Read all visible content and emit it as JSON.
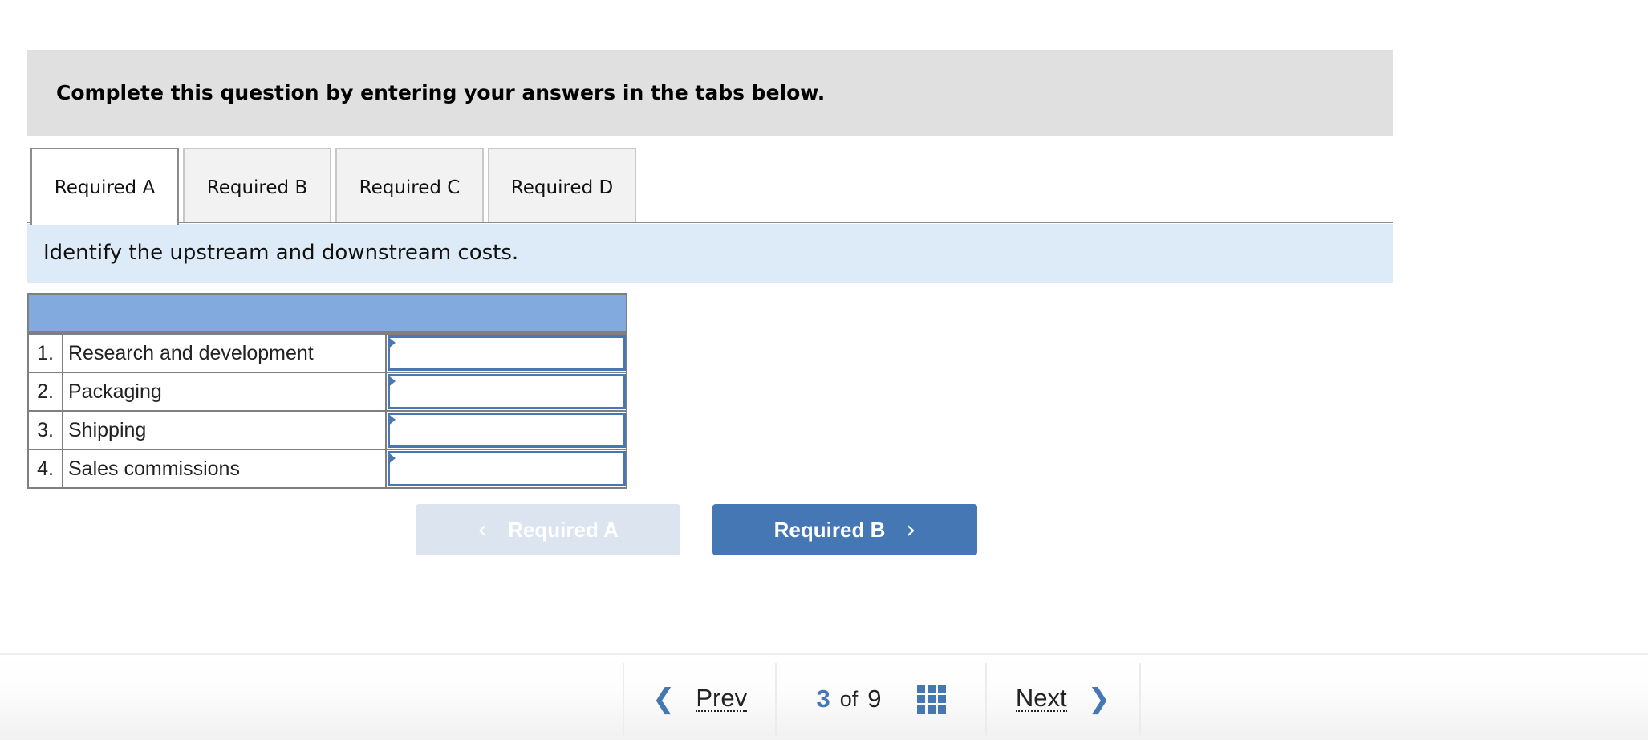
{
  "instructions": {
    "text": "Complete this question by entering your answers in the tabs below."
  },
  "tabs": [
    {
      "label": "Required A",
      "active": true
    },
    {
      "label": "Required B",
      "active": false
    },
    {
      "label": "Required C",
      "active": false
    },
    {
      "label": "Required D",
      "active": false
    }
  ],
  "prompt": {
    "text": "Identify the upstream and downstream costs."
  },
  "table": {
    "header": "",
    "rows": [
      {
        "num": "1.",
        "label": "Research and development",
        "value": ""
      },
      {
        "num": "2.",
        "label": "Packaging",
        "value": ""
      },
      {
        "num": "3.",
        "label": "Shipping",
        "value": ""
      },
      {
        "num": "4.",
        "label": "Sales commissions",
        "value": ""
      }
    ]
  },
  "buttons": {
    "prev_required": {
      "label": "Required A",
      "chevron": "‹",
      "disabled": true
    },
    "next_required": {
      "label": "Required B",
      "chevron": "›",
      "disabled": false
    }
  },
  "footer": {
    "prev_label": "Prev",
    "next_label": "Next",
    "current_page": "3",
    "of_label": "of",
    "total_pages": "9",
    "prev_icon": "❮",
    "next_icon": "❯"
  },
  "colors": {
    "accent": "#4677b5",
    "table_header": "#82aadf",
    "info_band": "#ddeaf7",
    "instruction_box": "#e0e0e0"
  }
}
